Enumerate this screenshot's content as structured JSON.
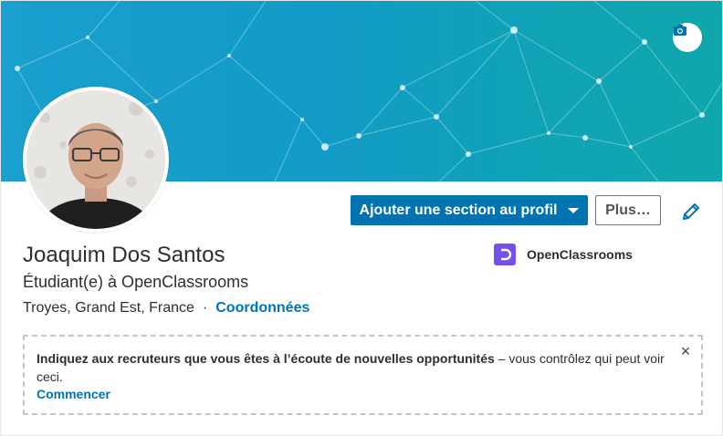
{
  "profile": {
    "name": "Joaquim Dos Santos",
    "headline": "Étudiant(e) à OpenClassrooms",
    "location": "Troyes, Grand Est, France",
    "separator": "·",
    "contact_link": "Coordonnées"
  },
  "actions": {
    "add_section_label": "Ajouter une section au profil",
    "more_label": "Plus…"
  },
  "organization": {
    "name": "OpenClassrooms",
    "logo_color": "#7451eb"
  },
  "notice": {
    "bold_text": "Indiquez aux recruteurs que vous êtes à l’écoute de nouvelles opportunités",
    "rest_text": " – vous contrôlez qui peut voir ceci.",
    "link_label": "Commencer",
    "close_symbol": "×"
  },
  "icons": {
    "banner_edit": "camera-icon",
    "profile_edit": "pencil-icon",
    "dropdown": "caret-down-icon",
    "close": "close-icon"
  },
  "colors": {
    "accent": "#0073b1",
    "banner_start": "#1a9fcf",
    "banner_end": "#0fa7ac"
  }
}
